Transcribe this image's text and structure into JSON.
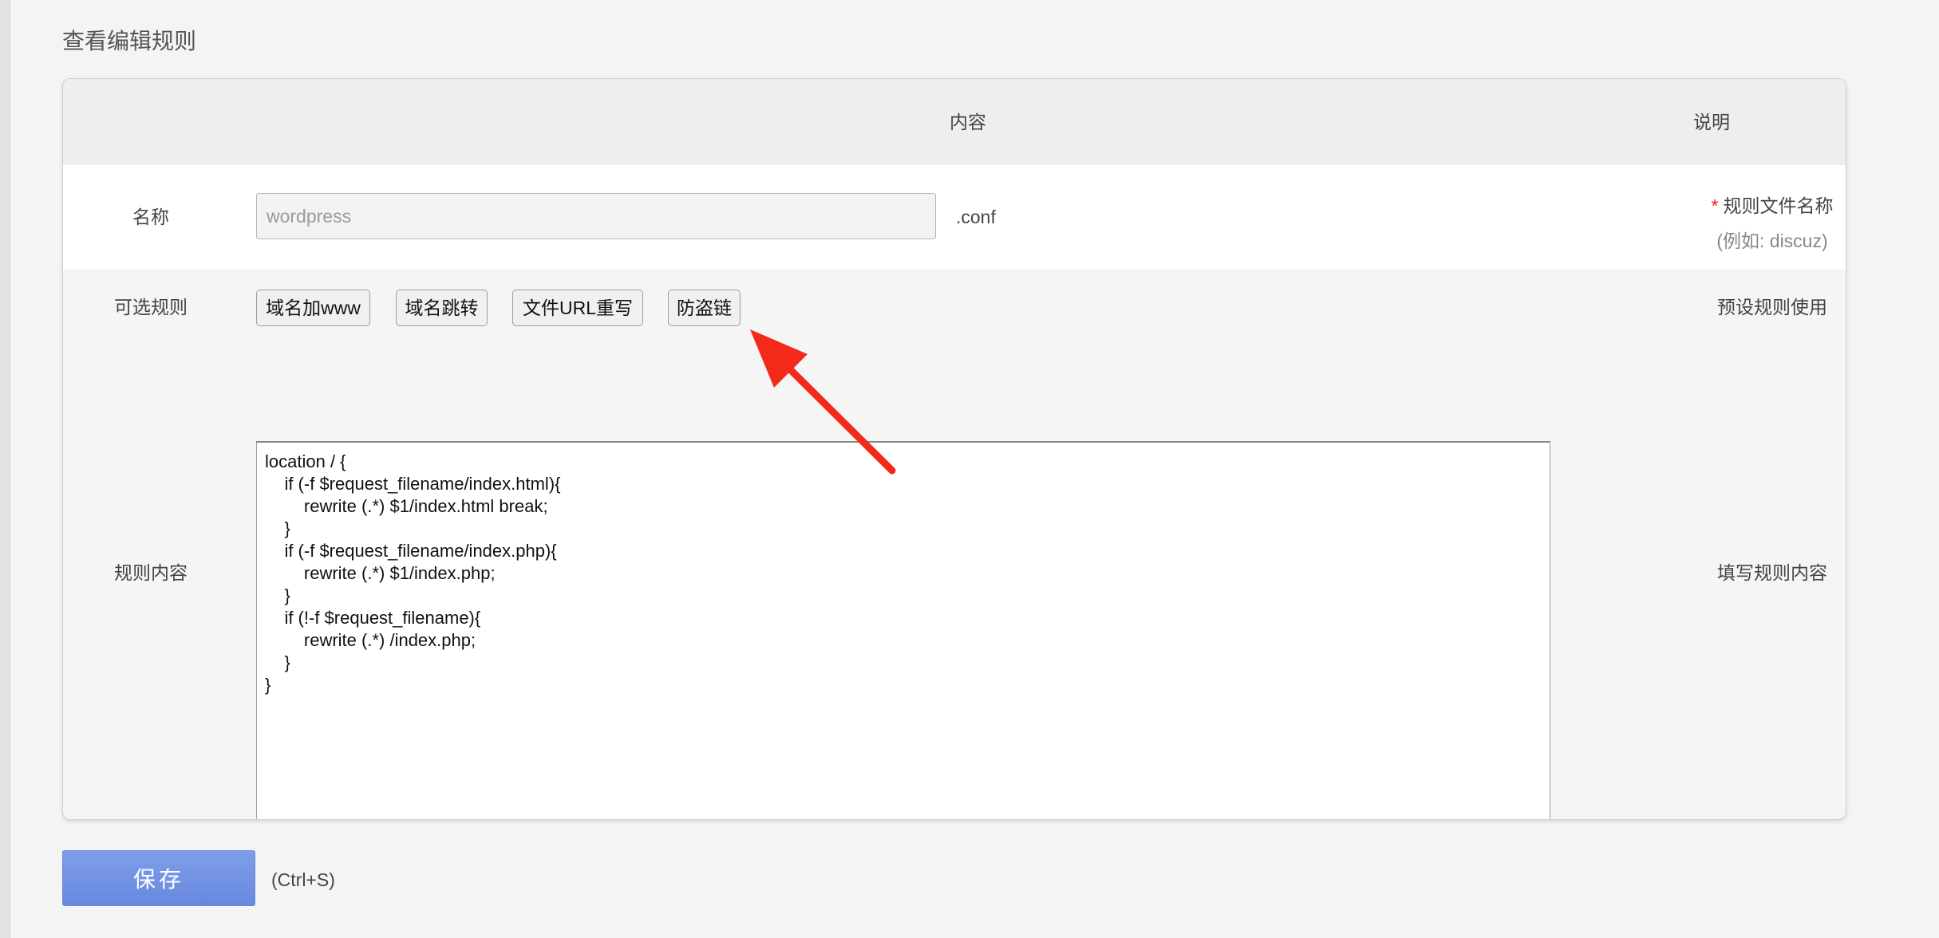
{
  "page": {
    "title": "查看编辑规则"
  },
  "table": {
    "header": {
      "content": "内容",
      "description": "说明"
    },
    "name_row": {
      "label": "名称",
      "input_value": "wordpress",
      "suffix": ".conf",
      "required_mark": "*",
      "description": "规则文件名称",
      "example": "(例如: discuz)"
    },
    "optional_row": {
      "label": "可选规则",
      "buttons": [
        "域名加www",
        "域名跳转",
        "文件URL重写",
        "防盗链"
      ],
      "description": "预设规则使用"
    },
    "rule_row": {
      "label": "规则内容",
      "content": "location / {\n    if (-f $request_filename/index.html){\n        rewrite (.*) $1/index.html break;\n    }\n    if (-f $request_filename/index.php){\n        rewrite (.*) $1/index.php;\n    }\n    if (!-f $request_filename){\n        rewrite (.*) /index.php;\n    }\n}",
      "description": "填写规则内容"
    }
  },
  "footer": {
    "save_label": "保存",
    "shortcut": "(Ctrl+S)"
  },
  "annotation": {
    "arrow_color": "#f32a1a"
  }
}
